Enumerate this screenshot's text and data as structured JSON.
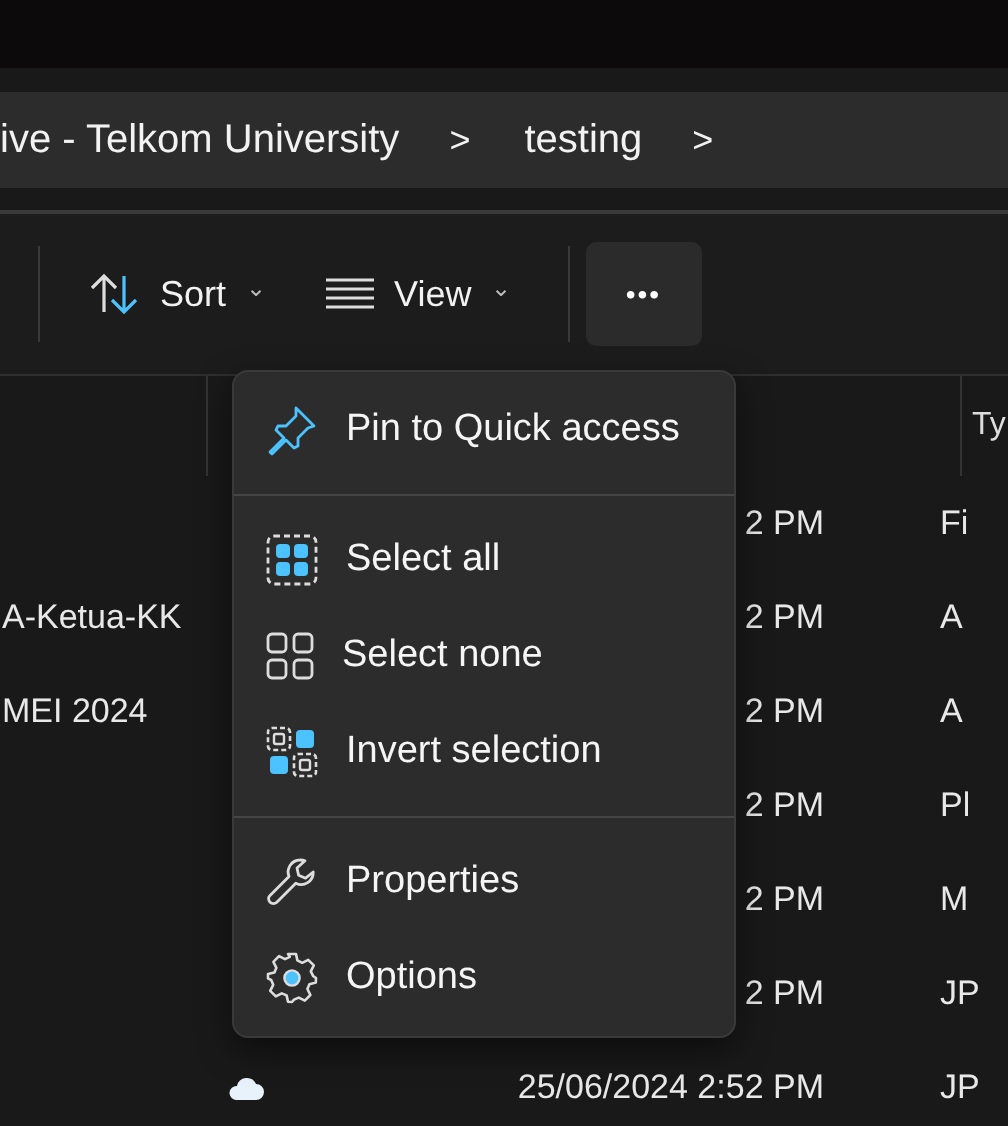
{
  "breadcrumb": [
    {
      "label": "ive - Telkom University",
      "separator": ">"
    },
    {
      "label": "testing",
      "separator": ">"
    }
  ],
  "toolbar": {
    "sort": {
      "label": "Sort",
      "caret": "⌄"
    },
    "view": {
      "label": "View",
      "caret": "⌄"
    },
    "more": {
      "label": "•••",
      "expanded": true
    }
  },
  "table": {
    "type_header": "Ty",
    "rows": [
      {
        "date": "2 PM",
        "type": "Fi"
      },
      {
        "name": "A-Ketua-KK",
        "date": "2 PM",
        "type": "A"
      },
      {
        "name": "MEI 2024",
        "date": "2 PM",
        "type": "A"
      },
      {
        "date": "2 PM",
        "type": "Pl"
      },
      {
        "date": "2 PM",
        "type": "M"
      },
      {
        "date": "2 PM",
        "type": "JP"
      },
      {
        "date": "25/06/2024 2:52 PM",
        "type": "JP",
        "kind": "cloud"
      }
    ]
  },
  "menu": {
    "groups": [
      {
        "items": [
          {
            "kind": "pin",
            "label": "Pin to Quick access"
          }
        ]
      },
      {
        "items": [
          {
            "kind": "select-all",
            "label": "Select all"
          },
          {
            "kind": "select-none",
            "label": "Select none"
          },
          {
            "kind": "invert",
            "label": "Invert selection"
          }
        ]
      },
      {
        "items": [
          {
            "kind": "properties",
            "label": "Properties"
          },
          {
            "kind": "options",
            "label": "Options"
          }
        ]
      }
    ]
  }
}
